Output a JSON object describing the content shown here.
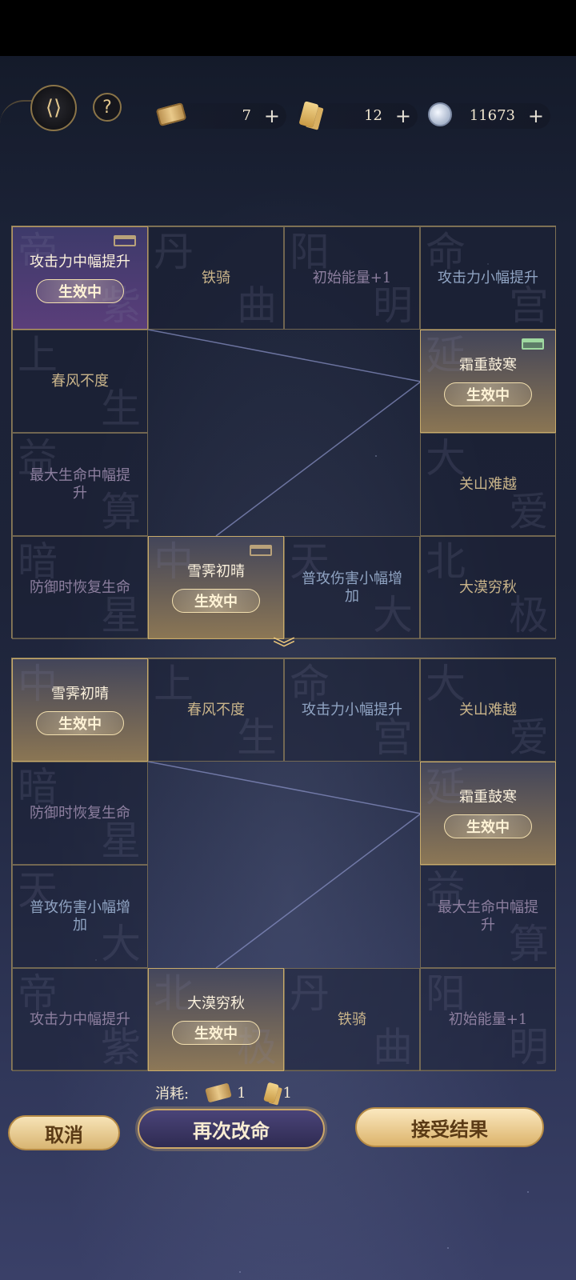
{
  "header": {
    "back_icon": "back-arrow-icon",
    "help_label": "?",
    "resources": [
      {
        "icon": "scroll-icon",
        "value": "7",
        "plus": "+"
      },
      {
        "icon": "tablet-icon",
        "value": "12",
        "plus": "+"
      },
      {
        "icon": "coin-icon",
        "value": "11673",
        "plus": "+"
      }
    ]
  },
  "current_board": {
    "cells": [
      {
        "label": "攻击力中幅提升",
        "status": "生效中",
        "bg": [
          "帝",
          "紫"
        ]
      },
      {
        "label": "铁骑",
        "bg": [
          "丹",
          "曲"
        ]
      },
      {
        "label": "初始能量+1",
        "bg": [
          "阳",
          "明"
        ]
      },
      {
        "label": "攻击力小幅提升",
        "bg": [
          "命",
          "宫"
        ]
      },
      {
        "label": "春风不度",
        "bg": [
          "上",
          "生"
        ]
      },
      {
        "label": "霜重鼓寒",
        "status": "生效中",
        "bg": [
          "延",
          ""
        ]
      },
      {
        "label": "最大生命中幅提升",
        "bg": [
          "益",
          "算"
        ]
      },
      {
        "label": "关山难越",
        "bg": [
          "大",
          "爱"
        ]
      },
      {
        "label": "防御时恢复生命",
        "bg": [
          "暗",
          "星"
        ]
      },
      {
        "label": "雪霁初晴",
        "status": "生效中",
        "bg": [
          "中",
          ""
        ]
      },
      {
        "label": "普攻伤害小幅增加",
        "bg": [
          "天",
          "大"
        ]
      },
      {
        "label": "大漠穷秋",
        "bg": [
          "北",
          "极"
        ]
      }
    ]
  },
  "new_board": {
    "cells": [
      {
        "label": "雪霁初晴",
        "status": "生效中",
        "bg": [
          "中",
          ""
        ]
      },
      {
        "label": "春风不度",
        "bg": [
          "上",
          "生"
        ]
      },
      {
        "label": "攻击力小幅提升",
        "bg": [
          "命",
          "宫"
        ]
      },
      {
        "label": "关山难越",
        "bg": [
          "大",
          "爱"
        ]
      },
      {
        "label": "防御时恢复生命",
        "bg": [
          "暗",
          "星"
        ]
      },
      {
        "label": "霜重鼓寒",
        "status": "生效中",
        "bg": [
          "延",
          ""
        ]
      },
      {
        "label": "普攻伤害小幅增加",
        "bg": [
          "天",
          "大"
        ]
      },
      {
        "label": "最大生命中幅提升",
        "bg": [
          "益",
          "算"
        ]
      },
      {
        "label": "攻击力中幅提升",
        "bg": [
          "帝",
          "紫"
        ]
      },
      {
        "label": "大漠穷秋",
        "status": "生效中",
        "bg": [
          "北",
          "极"
        ]
      },
      {
        "label": "铁骑",
        "bg": [
          "丹",
          "曲"
        ]
      },
      {
        "label": "初始能量+1",
        "bg": [
          "阳",
          "明"
        ]
      }
    ]
  },
  "cost": {
    "label": "消耗:",
    "scroll_count": "1",
    "tablet_count": "1"
  },
  "buttons": {
    "cancel": "取消",
    "reroll": "再次改命",
    "accept": "接受结果"
  },
  "colors": {
    "gold_text": "#e8d3a4",
    "active_gold": "#c8ab6b",
    "active_purple": "#5a3e7a",
    "frame": "#8d7d59"
  }
}
